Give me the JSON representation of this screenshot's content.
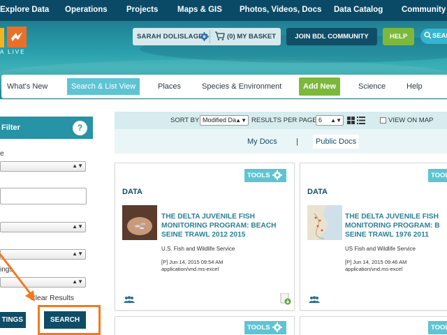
{
  "top_nav": [
    "Explore Data",
    "Operations",
    "Projects",
    "Maps & GIS",
    "Photos, Videos, Docs",
    "Data Catalog",
    "Community"
  ],
  "logo": {
    "tagline": "A LIVE",
    "colors": [
      "#f2b51e",
      "#e8702a"
    ]
  },
  "user": {
    "name": "SARAH DOLISLAGER",
    "basket": "(0) MY BASKET"
  },
  "header_buttons": {
    "join": "JOIN BDL COMMUNITY",
    "help": "HELP",
    "search": "SEAR"
  },
  "sub_nav": [
    "What's New",
    "Search & List View",
    "Places",
    "Species & Environment",
    "Add New",
    "Science",
    "Help"
  ],
  "filter": {
    "title": "Filter",
    "help_glyph": "?",
    "labels": [
      "e",
      "ings"
    ],
    "clear": "Clear Results",
    "settings_btn": "TINGS",
    "search_btn": "SEARCH"
  },
  "sort_bar": {
    "sort_by": "SORT BY",
    "sort_value": "Modified Da",
    "per_page_label": "RESULTS PER PAGE",
    "per_page_value": "6",
    "map_label": "VIEW ON MAP"
  },
  "doc_tabs": {
    "my": "My Docs",
    "separator": "|",
    "public": "Public Docs"
  },
  "results": [
    {
      "tools": "TOOLS",
      "type": "DATA",
      "title": "THE DELTA JUVENILE FISH MONITORING PROGRAM: BEACH SEINE TRAWL 2012 2015",
      "org": "U.S. Fish and Wildlife Service",
      "date": "[P] Jun 14, 2015 09:54 AM",
      "format": "application/vnd.ms-excel"
    },
    {
      "tools": "TOOL",
      "type": "DATA",
      "title": "THE DELTA JUVENILE FISH MONITORING PROGRAM: B SEINE TRAWL 1976 2011",
      "org": "US Fish and Wildlife Service",
      "date": "[P] Jun 14, 2015 09:46 AM",
      "format": "application/vnd.ms-excel"
    },
    {
      "tools": "TOOLS"
    },
    {
      "tools": "TOOL"
    }
  ],
  "colors": {
    "nav": "#0b4a66",
    "accent": "#5ec4d4",
    "green": "#7cb83c",
    "highlight": "#f07a1e"
  }
}
